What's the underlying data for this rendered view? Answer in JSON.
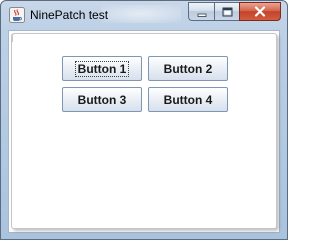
{
  "window": {
    "title": "NinePatch test",
    "app_icon": "java-cup-icon",
    "controls": {
      "minimize_icon": "minimize-icon",
      "maximize_icon": "maximize-icon",
      "close_icon": "close-icon"
    }
  },
  "buttons": [
    {
      "label": "Button 1",
      "focused": true
    },
    {
      "label": "Button 2",
      "focused": false
    },
    {
      "label": "Button 3",
      "focused": false
    },
    {
      "label": "Button 4",
      "focused": false
    }
  ],
  "colors": {
    "close_button": "#c3432b",
    "titlebar": "#bcd0e6",
    "button_border": "#7f97b3"
  }
}
